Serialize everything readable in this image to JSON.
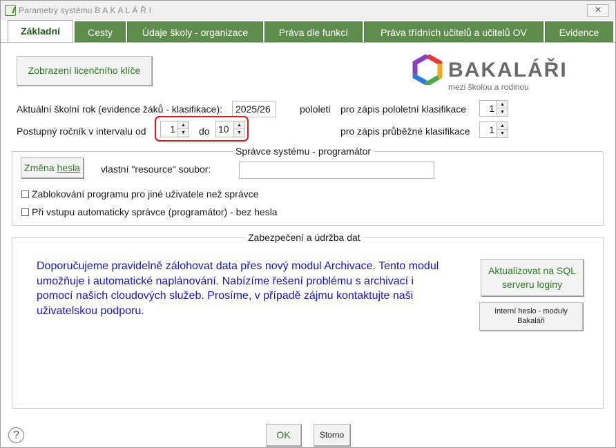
{
  "window": {
    "title": "Parametry systému  B A K A L Á Ř I",
    "close_label": "✕"
  },
  "tabs": [
    {
      "label": "Základní",
      "active": true
    },
    {
      "label": "Cesty",
      "active": false
    },
    {
      "label": "Údaje školy - organizace",
      "active": false
    },
    {
      "label": "Práva dle funkcí",
      "active": false
    },
    {
      "label": "Práva třídních učitelů a učitelů OV",
      "active": false
    },
    {
      "label": "Evidence",
      "active": false
    }
  ],
  "license_button": "Zobrazení licenčního klíče",
  "logo": {
    "name": "BAKALÁŘI",
    "tagline": "mezi školou a rodinou"
  },
  "school_year": {
    "label": "Aktuální školní rok (evidence žáků - klasifikace):",
    "value": "2025/26"
  },
  "pololeti_label": "pololetí",
  "pololetni": {
    "label": "pro zápis pololetní klasifikace",
    "value": "1"
  },
  "prubezne": {
    "label": "pro zápis průběžné klasifikace",
    "value": "1"
  },
  "grade_range": {
    "label": "Postupný ročník v intervalu od",
    "from": "1",
    "to_label": "do",
    "to": "10"
  },
  "admin_group": {
    "legend": "Správce systému - programátor",
    "change_password_pre": "Změna ",
    "change_password_link": "hesla",
    "resource_label": "vlastní \"resource\" soubor:",
    "resource_value": "",
    "block_program_label": "Zablokování programu pro jiné uživatele než správce",
    "auto_admin_label": "Při vstupu automaticky správce (programátor) - bez hesla"
  },
  "security_group": {
    "legend": "Zabezpečení a údržba dat",
    "message": "Doporučujeme pravidelně zálohovat data přes nový modul Archivace. Tento modul umožňuje i automatické naplánování. Nabízíme řešení problému s archivací i pomocí našich cloudových služeb. Prosíme, v případě zájmu kontaktujte naši uživatelskou podporu.",
    "sql_button": "Aktualizovat na SQL serveru loginy",
    "internal_password_button": "Interní heslo - moduly Bakaláři"
  },
  "footer": {
    "help": "?",
    "ok": "OK",
    "cancel": "Storno"
  },
  "colors": {
    "tab_green": "#5e8c4c",
    "accent_green": "#2c7a24",
    "message_blue": "#1414c8",
    "highlight_red": "#e11515"
  }
}
